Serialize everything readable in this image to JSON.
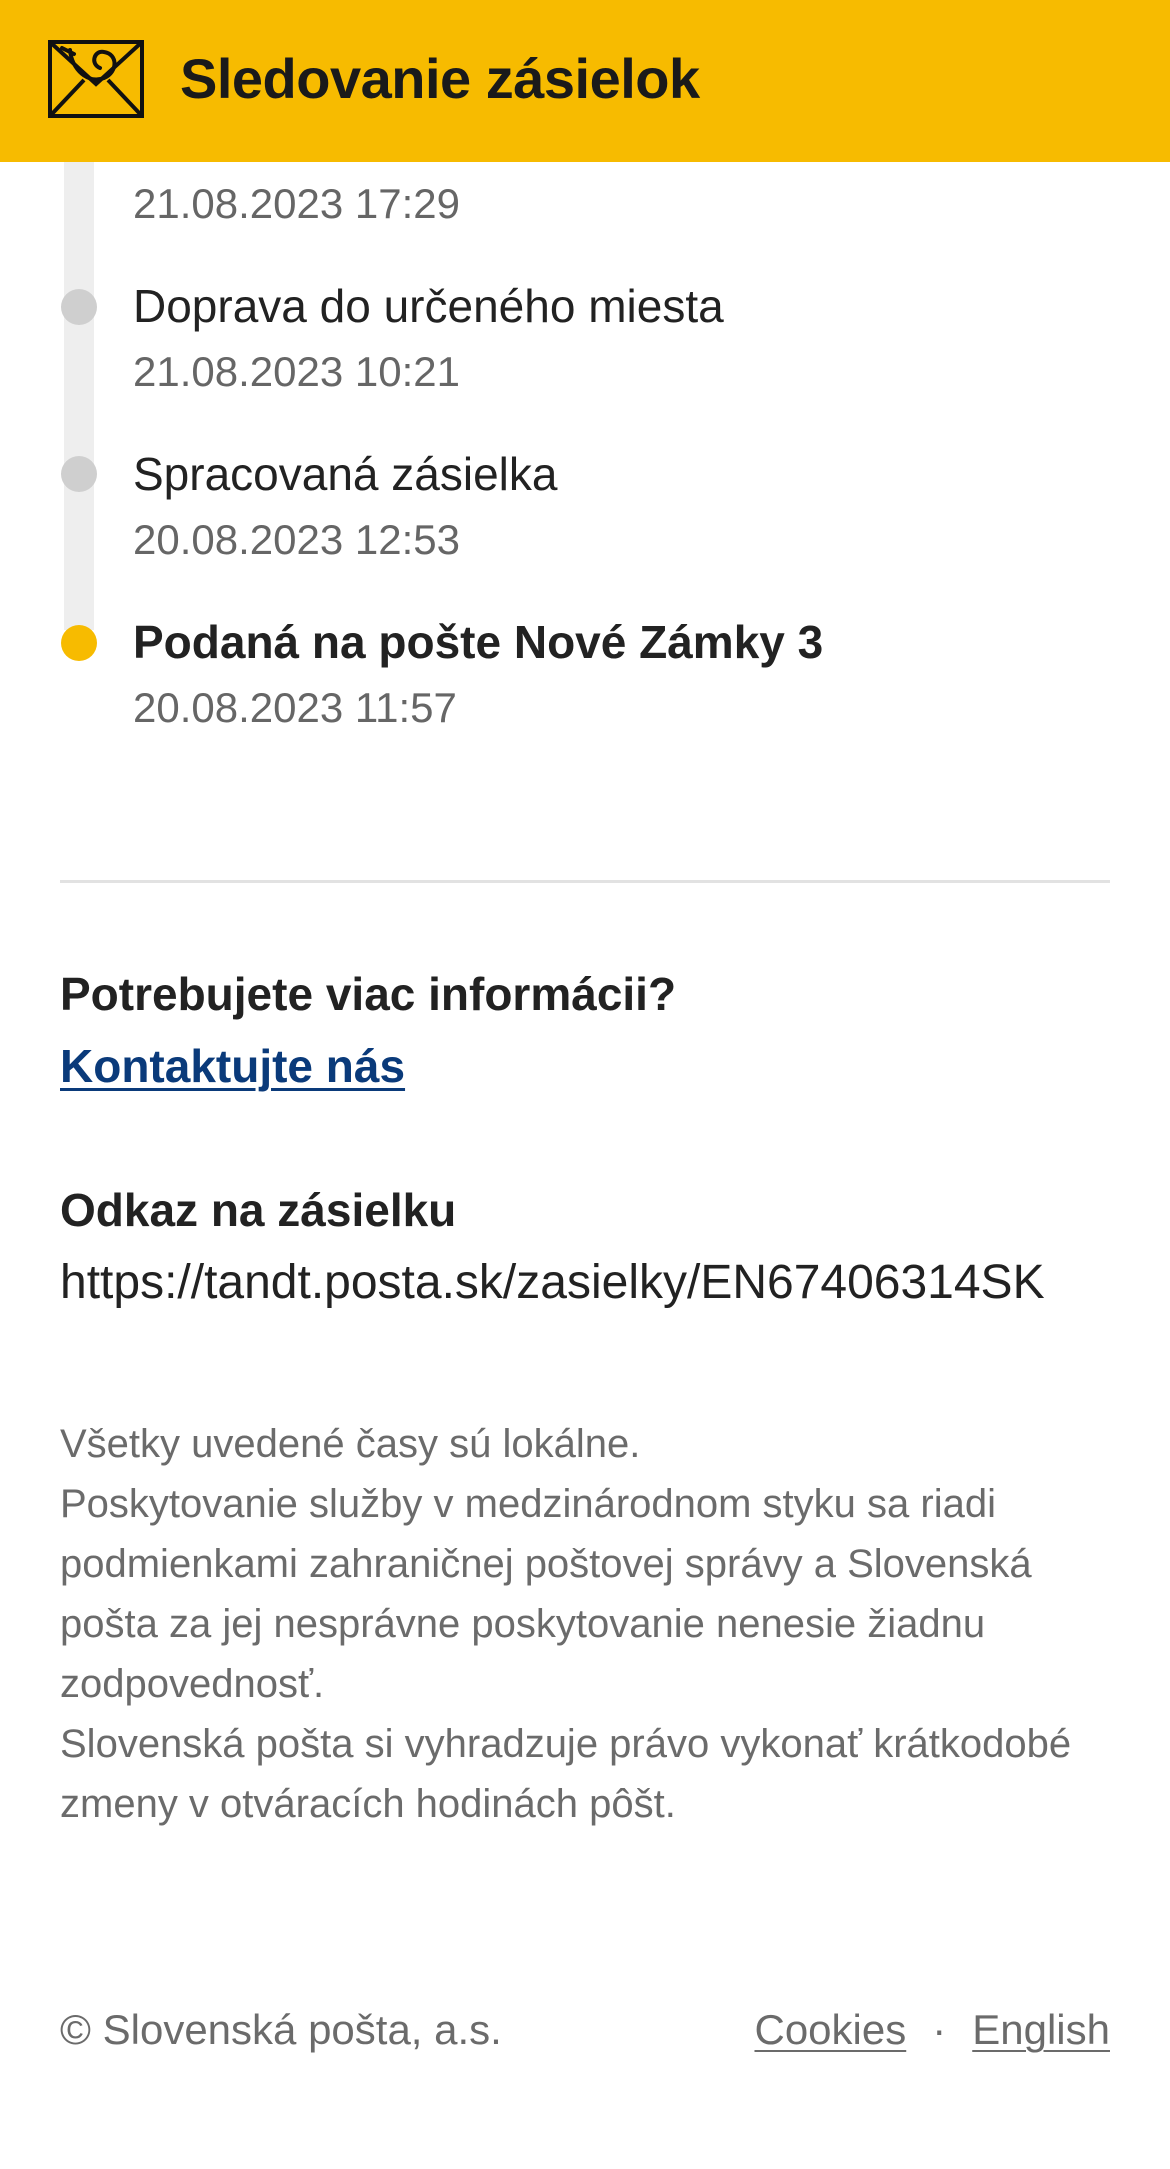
{
  "header": {
    "title": "Sledovanie zásielok",
    "logo_icon": "posthorn-envelope-icon",
    "background_color": "#f7bb00"
  },
  "timeline": {
    "events": [
      {
        "title": "",
        "time": "21.08.2023 17:29",
        "active": false
      },
      {
        "title": "Doprava do určeného miesta",
        "time": "21.08.2023 10:21",
        "active": false
      },
      {
        "title": "Spracovaná zásielka",
        "time": "20.08.2023 12:53",
        "active": false
      },
      {
        "title": "Podaná na pošte Nové Zámky 3",
        "time": "20.08.2023 11:57",
        "active": true
      }
    ],
    "active_color": "#f7bb00",
    "inactive_color": "#cfcfcf"
  },
  "help": {
    "heading": "Potrebujete viac informácii?",
    "link_label": "Kontaktujte nás"
  },
  "shipment_link": {
    "heading": "Odkaz na zásielku",
    "url": "https://tandt.posta.sk/zasielky/EN67406314SK"
  },
  "notice": {
    "line1": "Všetky uvedené časy sú lokálne.",
    "line2": "Poskytovanie služby v medzinárodnom styku sa riadi podmienkami zahraničnej poštovej správy a Slovenská pošta za jej nesprávne poskytovanie nenesie žiadnu zodpovednosť.",
    "line3": "Slovenská pošta si vyhradzuje právo vykonať krátkodobé zmeny v otváracích hodinách pôšt."
  },
  "footer": {
    "copyright": "© Slovenská pošta, a.s.",
    "cookies_label": "Cookies",
    "separator": "·",
    "language_label": "English"
  }
}
